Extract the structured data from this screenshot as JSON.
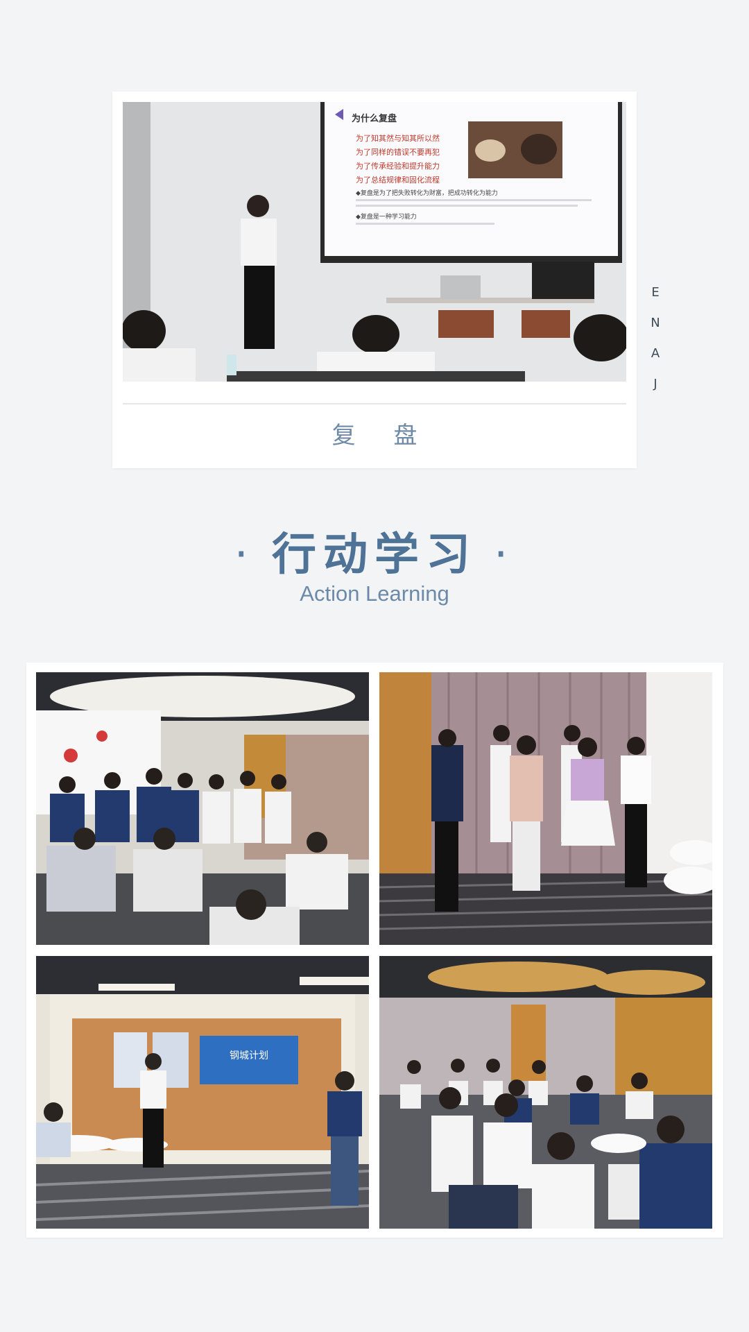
{
  "review_card": {
    "caption": "复 盘",
    "slide": {
      "heading": "为什么复盘",
      "bullets": [
        "为了知其然与知其所以然",
        "为了同样的错误不要再犯",
        "为了传承经验和提升能力",
        "为了总结规律和固化流程"
      ],
      "point_a": "◆复盘是为了把失败转化为财富，把成功转化为能力",
      "point_b": "◆复盘是一种学习能力"
    }
  },
  "side_label": [
    "J",
    "A",
    "N",
    "E"
  ],
  "section": {
    "title": "行动学习",
    "subtitle": "Action Learning"
  },
  "gallery": {
    "poster_banner": "钢城计划"
  },
  "colors": {
    "background": "#f3f4f6",
    "accent_title": "#4f7297",
    "caption": "#6f8aa7"
  }
}
